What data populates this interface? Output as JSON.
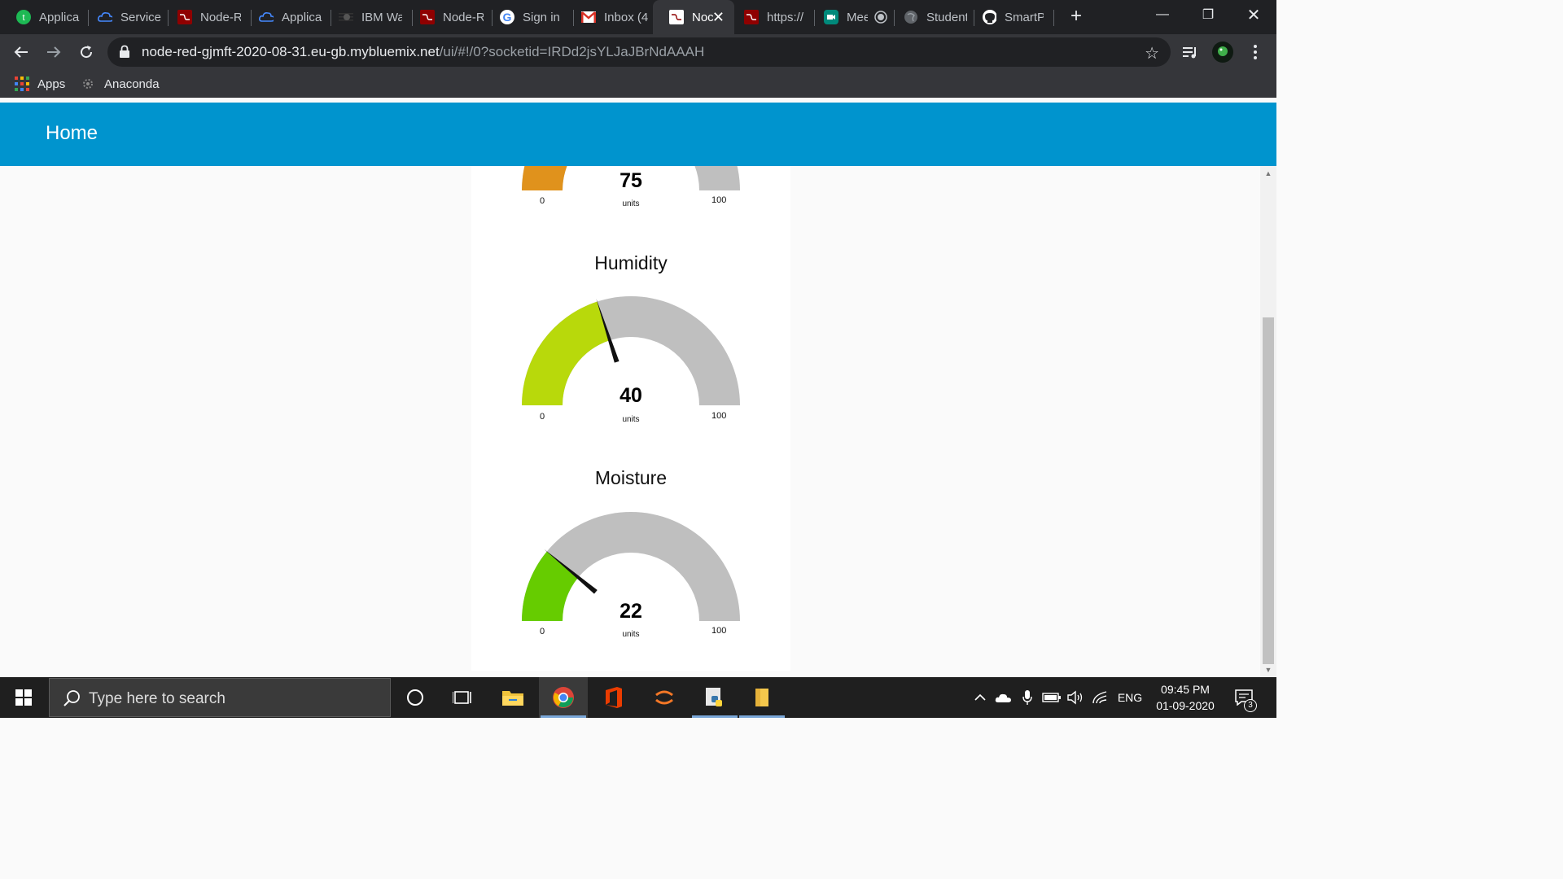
{
  "browser": {
    "tabs": [
      {
        "label": "Applica",
        "icon": "green-t-circle-icon",
        "active": false
      },
      {
        "label": "Service",
        "icon": "ibm-cloud-icon",
        "active": false
      },
      {
        "label": "Node-R",
        "icon": "node-red-icon",
        "active": false
      },
      {
        "label": "Applica",
        "icon": "ibm-cloud-icon",
        "active": false
      },
      {
        "label": "IBM Wa",
        "icon": "ibm-watson-icon",
        "active": false
      },
      {
        "label": "Node-R",
        "icon": "node-red-icon",
        "active": false
      },
      {
        "label": "Sign in",
        "icon": "google-icon",
        "active": false
      },
      {
        "label": "Inbox (4",
        "icon": "gmail-icon",
        "active": false
      },
      {
        "label": "Noc",
        "icon": "node-red-icon",
        "active": true
      },
      {
        "label": "https://",
        "icon": "node-red-icon",
        "active": false
      },
      {
        "label": "Mee",
        "icon": "google-meet-icon",
        "active": false
      },
      {
        "label": "Student",
        "icon": "globe-icon",
        "active": false
      },
      {
        "label": "SmartP",
        "icon": "github-icon",
        "active": false
      }
    ],
    "tab_close": "✕",
    "new_tab": "+",
    "window_controls": {
      "minimize": "—",
      "restore": "❐",
      "close": "✕"
    },
    "url_host": "node-red-gjmft-2020-08-31.eu-gb.mybluemix.net",
    "url_path": "/ui/#!/0?socketid=IRDd2jsYLJaJBrNdAAAH",
    "bookmarks": [
      {
        "label": "Apps",
        "icon": "apps-grid-icon"
      },
      {
        "label": "Anaconda",
        "icon": "anaconda-icon"
      }
    ]
  },
  "dashboard": {
    "title": "Home",
    "gauges": [
      {
        "name": "",
        "value": "75",
        "value_num": 75,
        "units": "units",
        "min": "0",
        "max": "100",
        "min_num": 0,
        "max_num": 100,
        "color": "#e0921c"
      },
      {
        "name": "Humidity",
        "value": "40",
        "value_num": 40,
        "units": "units",
        "min": "0",
        "max": "100",
        "min_num": 0,
        "max_num": 100,
        "color": "#b8d90b"
      },
      {
        "name": "Moisture",
        "value": "22",
        "value_num": 22,
        "units": "units",
        "min": "0",
        "max": "100",
        "min_num": 0,
        "max_num": 100,
        "color": "#66cc00"
      }
    ],
    "gauge_track_color": "#bfbfbf",
    "appbar_color": "#0094ce"
  },
  "taskbar": {
    "search_placeholder": "Type here to search",
    "apps": [
      {
        "name": "cortana-icon"
      },
      {
        "name": "task-view-icon"
      },
      {
        "name": "file-explorer-icon"
      },
      {
        "name": "chrome-icon"
      },
      {
        "name": "office-icon"
      },
      {
        "name": "jupyter-icon"
      },
      {
        "name": "python-idle-icon"
      },
      {
        "name": "folder-icon"
      }
    ],
    "language": "ENG",
    "time": "09:45 PM",
    "date": "01-09-2020",
    "notification_count": "3"
  }
}
